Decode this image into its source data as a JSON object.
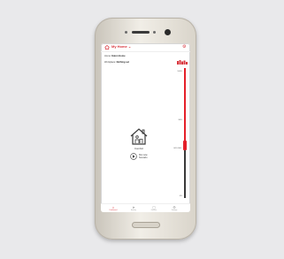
{
  "app": {
    "title": "My Home",
    "title_chevron": "⌄",
    "settings_icon": "gear-icon",
    "accent_color": "#d9363e"
  },
  "info": {
    "line1_label": "Home:",
    "line1_value": "Eaton Home",
    "line2_label": "Workplace:",
    "line2_value": "Nothing set"
  },
  "slider": {
    "top_label": "100%",
    "mid_label": "80%",
    "current_label": "60% 800",
    "bottom_label": "0%",
    "track_colors": [
      "#e4202a",
      "#3a3a3a"
    ]
  },
  "center": {
    "house_label": "Comfort",
    "play_label_line1": "Run now",
    "play_label_line2": "Scenario"
  },
  "nav": {
    "items": [
      {
        "icon": "⌂",
        "label": "Dashboard",
        "active": true
      },
      {
        "icon": "➤",
        "label": "Activity",
        "active": false
      },
      {
        "icon": "▢",
        "label": "Devices",
        "active": false
      },
      {
        "icon": "⚙",
        "label": "Settings",
        "active": false
      }
    ]
  }
}
